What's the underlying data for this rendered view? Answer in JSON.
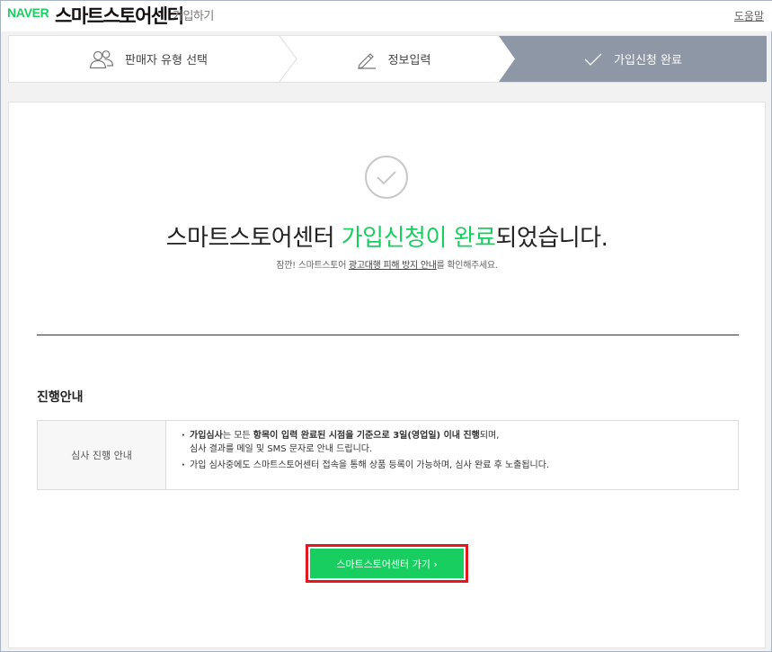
{
  "header": {
    "logo": "NAVER",
    "brand": "스마트스토어센터",
    "brand_sub": "가입하기",
    "help_link": "도움말"
  },
  "steps": [
    {
      "label": "판매자 유형 선택",
      "icon": "users-icon",
      "active": false
    },
    {
      "label": "정보입력",
      "icon": "pencil-icon",
      "active": false
    },
    {
      "label": "가입신청 완료",
      "icon": "check-icon",
      "active": true
    }
  ],
  "main": {
    "title_prefix": "스마트스토어센터 ",
    "title_highlight": "가입신청이 완료",
    "title_suffix": "되었습니다.",
    "notice_prefix": "잠깐! 스마트스토어 ",
    "notice_link": "광고대행 피해 방지 안내",
    "notice_suffix": "를 확인해주세요.",
    "section_title": "진행안내",
    "table": {
      "head": "심사 진행 안내",
      "row1_bold1": "가입심사",
      "row1_text1": "는 모든 ",
      "row1_bold2": "항목이 입력 완료된 시점을 기준으로 3일(영업일) 이내 진행",
      "row1_text2": "되며,",
      "row1_line2": "심사 결과를 메일 및 SMS 문자로 안내 드립니다.",
      "row2": "가입 심사중에도 스마트스토어센터 접속을 통해 상품 등록이 가능하며, 심사 완료 후 노출됩니다."
    },
    "cta_label": "스마트스토어센터 가기 ›"
  },
  "colors": {
    "accent": "#19ce60",
    "active_step": "#8e97a5",
    "highlight_border": "#e3181f"
  }
}
